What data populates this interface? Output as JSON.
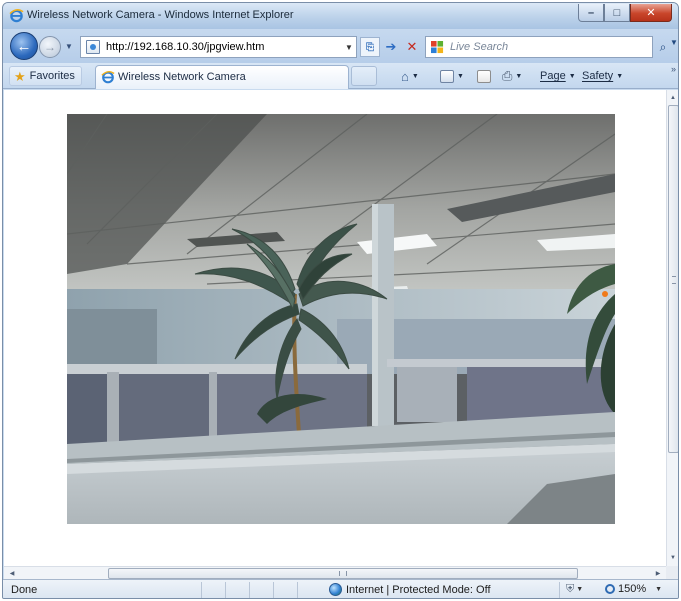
{
  "window": {
    "title": "Wireless Network Camera - Windows Internet Explorer",
    "minimize": "–",
    "maximize": "□",
    "close": "✕"
  },
  "navigation": {
    "address": "http://192.168.10.30/jpgview.htm",
    "search_placeholder": "Live Search"
  },
  "toolbar": {
    "favorites_label": "Favorites",
    "tab_label": "Wireless Network Camera",
    "page_label": "Page",
    "safety_label": "Safety"
  },
  "status": {
    "text": "Done",
    "zone": "Internet | Protected Mode: Off",
    "zoom": "150%"
  },
  "colors": {
    "frame": "#c9dbef",
    "close_button": "#c9462b",
    "accent": "#2c69bd"
  }
}
